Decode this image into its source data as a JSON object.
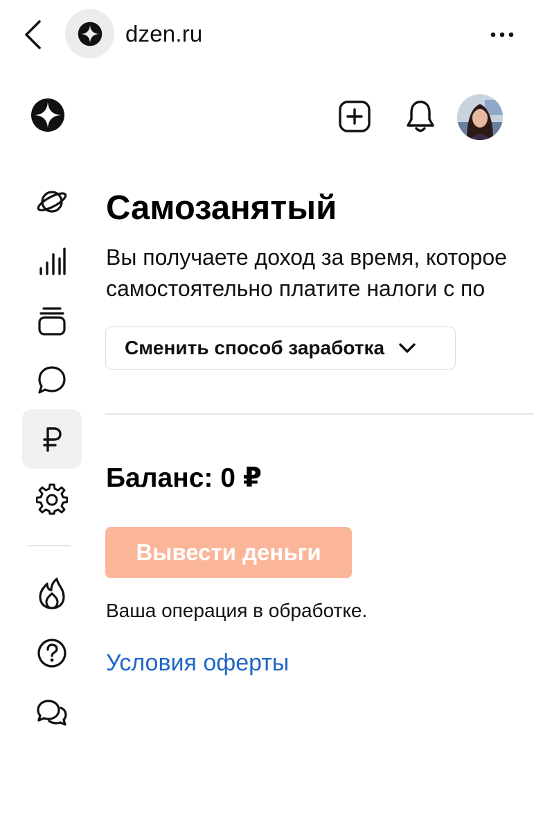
{
  "browser": {
    "url": "dzen.ru",
    "back_icon": "chevron-left-icon",
    "site_icon": "dzen-logo-icon",
    "more_icon": "more-dots-icon"
  },
  "header": {
    "logo_icon": "dzen-logo-icon",
    "create_icon": "plus-square-icon",
    "notifications_icon": "bell-icon",
    "avatar": "user-avatar"
  },
  "sidebar": {
    "items": [
      {
        "name": "feed",
        "icon": "planet-icon",
        "active": false
      },
      {
        "name": "statistics",
        "icon": "bar-chart-icon",
        "active": false
      },
      {
        "name": "publications",
        "icon": "stack-icon",
        "active": false
      },
      {
        "name": "comments",
        "icon": "speech-bubble-icon",
        "active": false
      },
      {
        "name": "monetization",
        "icon": "ruble-icon",
        "active": true
      },
      {
        "name": "settings",
        "icon": "gear-icon",
        "active": false
      },
      {
        "name": "trending",
        "icon": "flame-icon",
        "active": false
      },
      {
        "name": "help",
        "icon": "question-circle-icon",
        "active": false
      },
      {
        "name": "support-chat",
        "icon": "chat-bubbles-icon",
        "active": false
      }
    ]
  },
  "main": {
    "title": "Самозанятый",
    "description_line1": "Вы получаете доход за время, которое",
    "description_line2": "самостоятельно платите налоги с по",
    "switch_method_label": "Сменить способ заработка",
    "balance": "Баланс: 0 ₽",
    "withdraw_label": "Вывести деньги",
    "status": "Ваша операция в обработке.",
    "offer_link": "Условия оферты"
  },
  "colors": {
    "accent_button": "#fbb69a",
    "link": "#1f66c9",
    "active_sidebar_bg": "#f0f0f2"
  }
}
